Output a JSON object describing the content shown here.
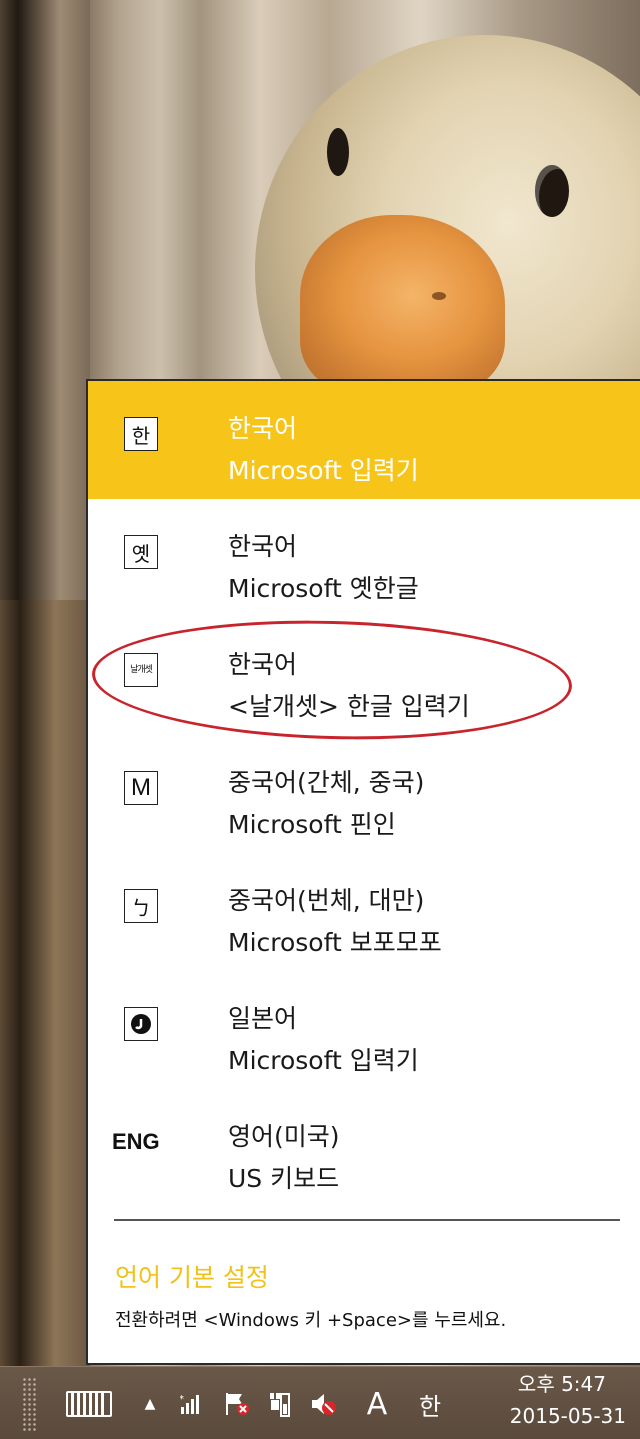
{
  "language_flyout": {
    "items": [
      {
        "icon": "한",
        "name": "한국어",
        "description": "Microsoft 입력기",
        "selected": true
      },
      {
        "icon": "옛",
        "name": "한국어",
        "description": "Microsoft 옛한글",
        "selected": false
      },
      {
        "icon": "날개셋",
        "name": "한국어",
        "description": "<날개셋> 한글 입력기",
        "selected": false
      },
      {
        "icon": "M",
        "name": "중국어(간체, 중국)",
        "description": "Microsoft 핀인",
        "selected": false
      },
      {
        "icon": "ㄅ",
        "name": "중국어(번체, 대만)",
        "description": "Microsoft 보포모포",
        "selected": false
      },
      {
        "icon": "japanese-ime-icon",
        "name": "일본어",
        "description": "Microsoft 입력기",
        "selected": false
      },
      {
        "icon": "ENG",
        "name": "영어(미국)",
        "description": "US 키보드",
        "selected": false
      }
    ],
    "preferences_link": "언어 기본 설정",
    "switch_hint": "전환하려면 <Windows 키 +Space>를 누르세요."
  },
  "taskbar": {
    "ime_mode": "A",
    "ime_language": "한",
    "clock_time": "오후 5:47",
    "clock_date": "2015-05-31"
  },
  "colors": {
    "selected_item": "#f7c51a",
    "link_text": "#f0c21a",
    "annotation": "#c8242c"
  }
}
